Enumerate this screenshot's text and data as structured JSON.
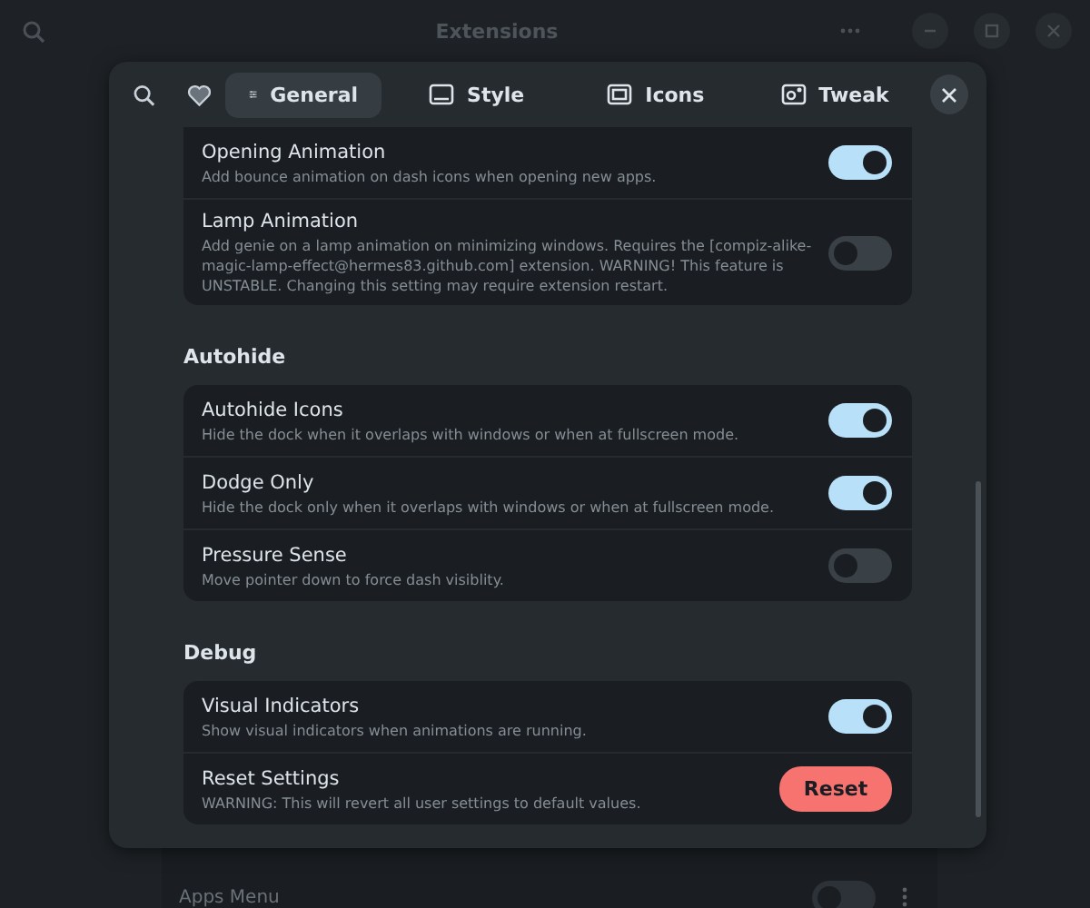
{
  "window": {
    "title": "Extensions"
  },
  "background_rows": [
    {
      "label": "Apps Menu",
      "on": false
    }
  ],
  "dialog": {
    "tabs": [
      {
        "label": "General",
        "selected": true
      },
      {
        "label": "Style",
        "selected": false
      },
      {
        "label": "Icons",
        "selected": false
      },
      {
        "label": "Tweak",
        "selected": false
      }
    ],
    "sections": [
      {
        "rows": [
          {
            "kind": "switch",
            "label": "Opening Animation",
            "description": "Add bounce animation on dash icons when opening new apps.",
            "on": true
          },
          {
            "kind": "switch",
            "label": "Lamp Animation",
            "description": "Add genie on a lamp animation on minimizing windows. Requires the [compiz-alike-magic-lamp-effect@hermes83.github.com] extension. WARNING! This feature is UNSTABLE. Changing this setting may require extension restart.",
            "on": false
          }
        ]
      },
      {
        "title": "Autohide",
        "rows": [
          {
            "kind": "switch",
            "label": "Autohide Icons",
            "description": "Hide the dock when it overlaps with windows or when at fullscreen mode.",
            "on": true
          },
          {
            "kind": "switch",
            "label": "Dodge Only",
            "description": "Hide the dock only when it overlaps with windows or when at fullscreen mode.",
            "on": true
          },
          {
            "kind": "switch",
            "label": "Pressure Sense",
            "description": "Move pointer down to force dash visiblity.",
            "on": false
          }
        ]
      },
      {
        "title": "Debug",
        "rows": [
          {
            "kind": "switch",
            "label": "Visual Indicators",
            "description": "Show visual indicators when animations are running.",
            "on": true
          },
          {
            "kind": "button",
            "label": "Reset Settings",
            "description": "WARNING: This will revert all user settings to default values.",
            "button": "Reset"
          }
        ]
      }
    ]
  }
}
